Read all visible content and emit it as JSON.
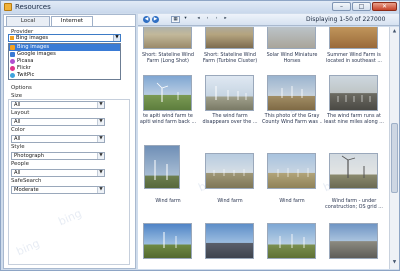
{
  "window": {
    "title": "Resources",
    "min_label": "–",
    "max_label": "□",
    "close_label": "✕"
  },
  "tabs": {
    "local": "Local",
    "internet": "Internet"
  },
  "provider": {
    "label": "Provider",
    "selected": "Bing images",
    "options": [
      {
        "label": "Bing images",
        "icon": "bing-icon",
        "color": "#f4a21f"
      },
      {
        "label": "Google images",
        "icon": "google-icon",
        "color": "#3a7bd5"
      },
      {
        "label": "Picasa",
        "icon": "picasa-icon",
        "color": "#b04fd0"
      },
      {
        "label": "Flickr",
        "icon": "flickr-icon",
        "color": "#e0338a"
      },
      {
        "label": "TwitPic",
        "icon": "twitpic-icon",
        "color": "#3fa3dd"
      }
    ]
  },
  "options": {
    "title": "Options",
    "fields": [
      {
        "label": "Size",
        "value": "All"
      },
      {
        "label": "Layout",
        "value": "All"
      },
      {
        "label": "Color",
        "value": "All"
      },
      {
        "label": "Style",
        "value": "Photograph"
      },
      {
        "label": "People",
        "value": "All"
      },
      {
        "label": "SafeSearch",
        "value": "Moderate"
      }
    ]
  },
  "toolbar": {
    "nav_back": "◀",
    "nav_forward": "▶",
    "view_label": "▦",
    "first_label": "◂",
    "prev_label": "‹",
    "next_label": "›",
    "last_label": "▸",
    "status": "Displaying 1-50 of 227000"
  },
  "watermark": "bing",
  "gallery": {
    "accent": "#3a7bd5",
    "items": [
      {
        "caption1": "Short: Stateline Wind",
        "caption2": "Farm (Long Shot)"
      },
      {
        "caption1": "Short: Stateline Wind",
        "caption2": "Farm (Turbine Cluster)"
      },
      {
        "caption1": "Solar Wind Miniature",
        "caption2": "Horses"
      },
      {
        "caption1": "Summer Wind Farm is",
        "caption2": "located in southeast ..."
      },
      {
        "caption1": "te apiti wind farm te",
        "caption2": "apiti wind farm back ..."
      },
      {
        "caption1": "The wind farm",
        "caption2": "disappears over the ..."
      },
      {
        "caption1": "This photo of the Gray",
        "caption2": "County Wind Farm was ..."
      },
      {
        "caption1": "The wind farm runs at",
        "caption2": "least nine miles along ..."
      },
      {
        "caption1": "Wind farm",
        "caption2": ""
      },
      {
        "caption1": "Wind farm",
        "caption2": ""
      },
      {
        "caption1": "Wind farm",
        "caption2": ""
      },
      {
        "caption1": "Wind farm - under",
        "caption2": "construction; OS grid ..."
      },
      {
        "caption1": "",
        "caption2": ""
      },
      {
        "caption1": "",
        "caption2": ""
      },
      {
        "caption1": "",
        "caption2": ""
      },
      {
        "caption1": "",
        "caption2": ""
      }
    ]
  }
}
